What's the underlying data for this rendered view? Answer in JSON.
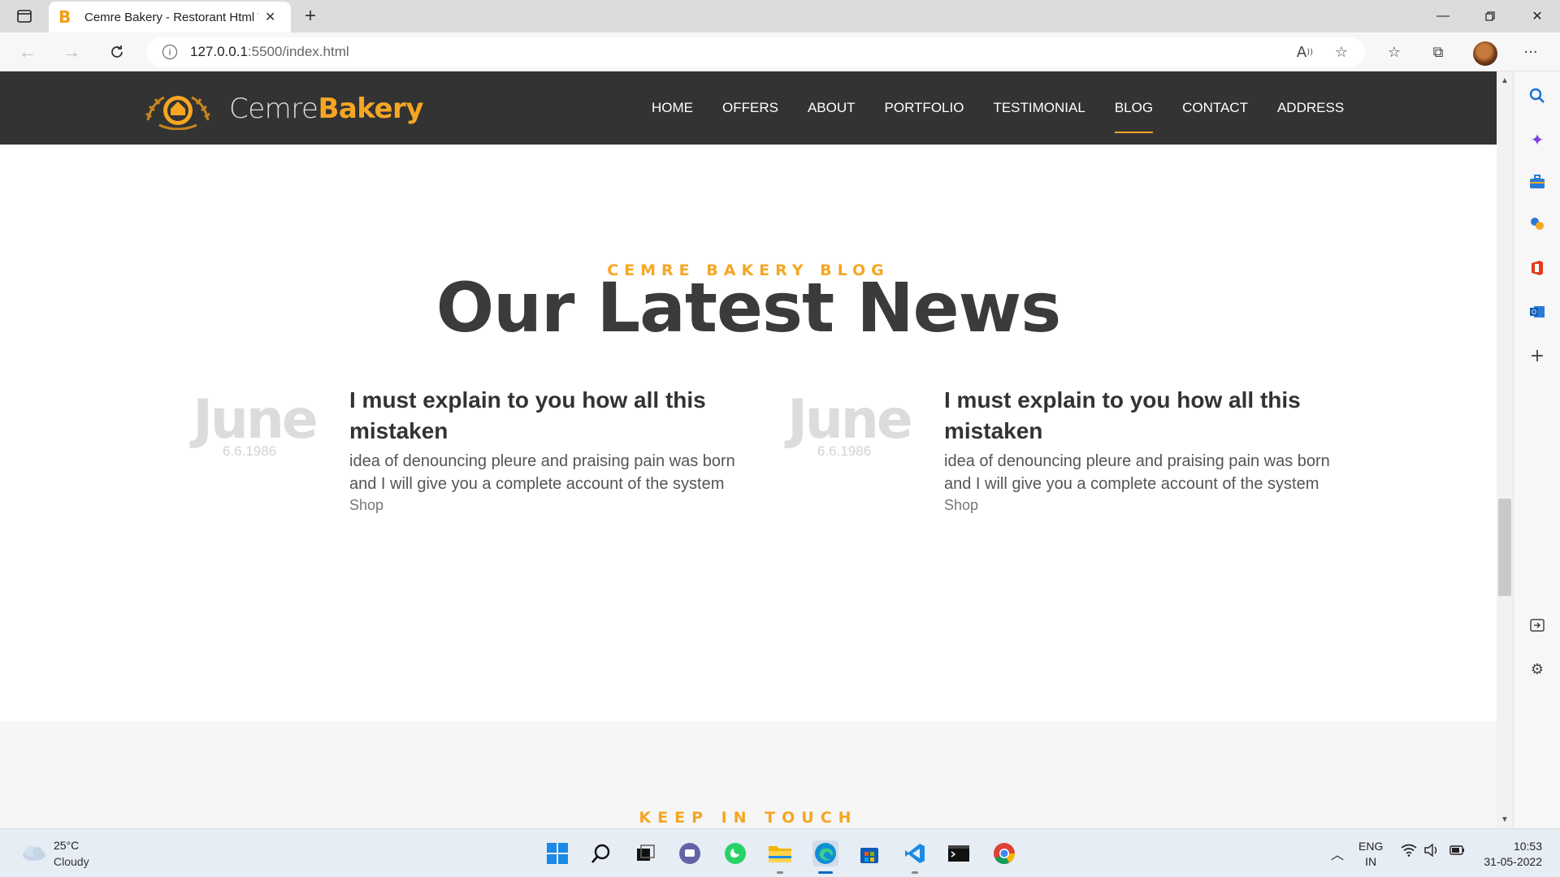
{
  "browser": {
    "tab_title": "Cemre Bakery - Restorant Html T",
    "tab_favicon": "B",
    "url_host": "127.0.0.1",
    "url_rest": ":5500/index.html"
  },
  "site": {
    "logo_text_light": "Cemre",
    "logo_text_brand": "Bakery",
    "nav": [
      "HOME",
      "OFFERS",
      "ABOUT",
      "PORTFOLIO",
      "TESTIMONIAL",
      "BLOG",
      "CONTACT",
      "ADDRESS"
    ],
    "active_nav": "BLOG"
  },
  "blog": {
    "eyebrow": "CEMRE BAKERY BLOG",
    "title": "Our Latest News",
    "posts": [
      {
        "month": "June",
        "date": "6.6.1986",
        "title": "I must explain to you how all this mistaken",
        "excerpt": "idea of denouncing pleure and praising pain was born and I will give you a complete account of the system",
        "link": "Shop"
      },
      {
        "month": "June",
        "date": "6.6.1986",
        "title": "I must explain to you how all this mistaken",
        "excerpt": "idea of denouncing pleure and praising pain was born and I will give you a complete account of the system",
        "link": "Shop"
      }
    ]
  },
  "contact": {
    "eyebrow": "KEEP IN TOUCH"
  },
  "taskbar": {
    "weather_temp": "25°C",
    "weather_condition": "Cloudy",
    "lang_top": "ENG",
    "lang_bottom": "IN",
    "time": "10:53",
    "date": "31-05-2022"
  },
  "colors": {
    "accent": "#f5a623",
    "header_bg": "#333333",
    "title": "#3b3b3b"
  }
}
